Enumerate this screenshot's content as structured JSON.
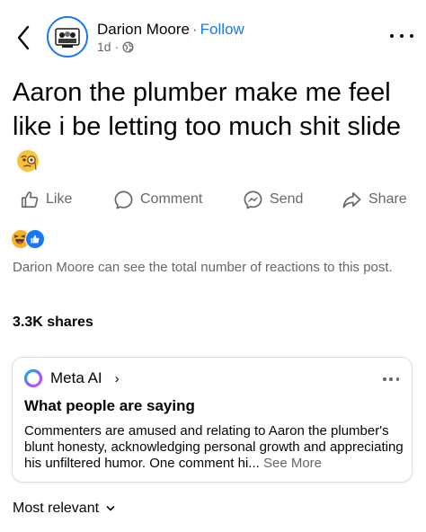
{
  "header": {
    "author": "Darion Moore",
    "separator": "·",
    "follow_label": "Follow",
    "time": "1d",
    "time_separator": "·"
  },
  "post": {
    "text": "Aaron the plumber make me feel like i be letting too much shit slide"
  },
  "actions": {
    "like": "Like",
    "comment": "Comment",
    "send": "Send",
    "share": "Share"
  },
  "reactions": {
    "note": "Darion Moore can see the total number of reactions to this post."
  },
  "shares": "3.3K shares",
  "meta_ai": {
    "title": "Meta AI",
    "chevron": "›",
    "heading": "What people are saying",
    "summary": "Commenters are amused and relating to Aaron the plumber's blunt honesty, acknowledging personal growth and appreciating his unfiltered humor. One comment hi...",
    "see_more": "See More"
  },
  "sort": {
    "label": "Most relevant"
  },
  "colors": {
    "accent": "#1877f2",
    "secondary_text": "#65676b"
  }
}
